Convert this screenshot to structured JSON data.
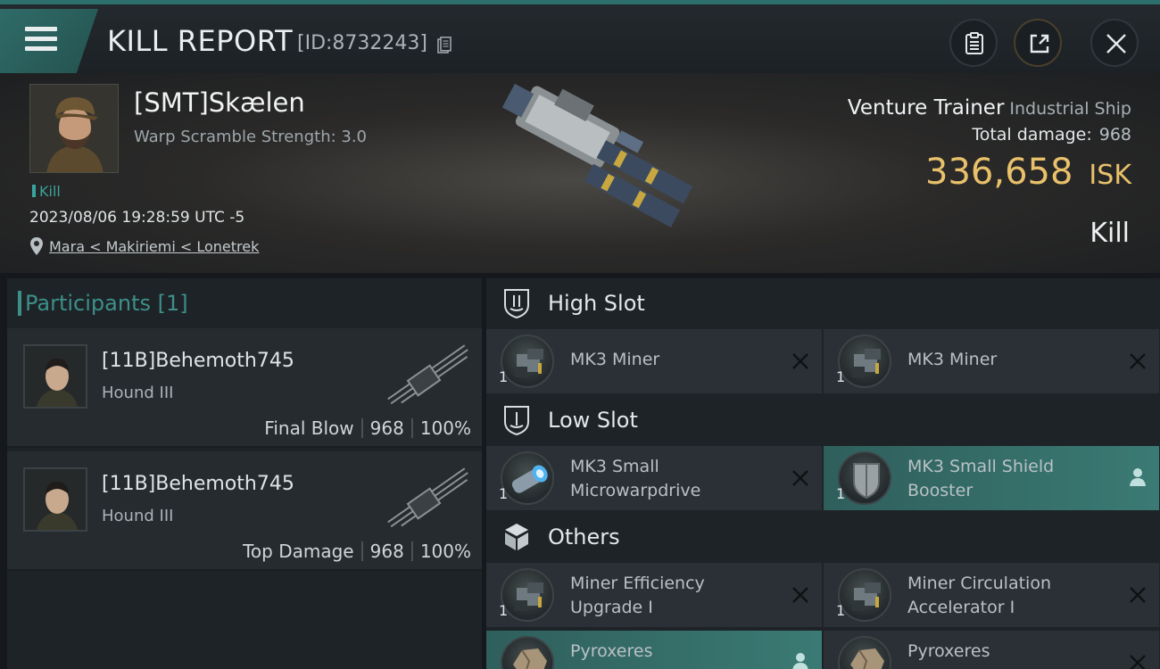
{
  "header": {
    "title": "KILL REPORT",
    "report_id": "[ID:8732243]"
  },
  "victim": {
    "name": "[SMT]Skælen",
    "warp_scramble": "Warp Scramble Strength: 3.0",
    "kill_tag": "Kill",
    "datetime": "2023/08/06 19:28:59 UTC -5",
    "location": "Mara < Makiriemi < Lonetrek"
  },
  "ship": {
    "name": "Venture Trainer",
    "class": "Industrial Ship",
    "total_damage_label": "Total damage:",
    "total_damage": "968",
    "isk_value": "336,658",
    "isk_unit": "ISK",
    "result": "Kill"
  },
  "participants": {
    "header": "Participants [1]",
    "items": [
      {
        "name": "[11B]Behemoth745",
        "ship": "Hound III",
        "role": "Final Blow",
        "damage": "968",
        "percent": "100%"
      },
      {
        "name": "[11B]Behemoth745",
        "ship": "Hound III",
        "role": "Top Damage",
        "damage": "968",
        "percent": "100%"
      }
    ]
  },
  "slots": {
    "high": {
      "label": "High Slot",
      "items": [
        {
          "name": "MK3 Miner",
          "qty": "1"
        },
        {
          "name": "MK3 Miner",
          "qty": "1"
        }
      ]
    },
    "low": {
      "label": "Low Slot",
      "items": [
        {
          "name": "MK3 Small Microwarpdrive",
          "qty": "1"
        },
        {
          "name": "MK3 Small Shield Booster",
          "qty": "1"
        }
      ]
    },
    "others": {
      "label": "Others",
      "items": [
        {
          "name": "Miner Efficiency Upgrade I",
          "qty": "1"
        },
        {
          "name": "Miner Circulation Accelerator I",
          "qty": "1"
        },
        {
          "name": "Pyroxeres",
          "qty": ""
        },
        {
          "name": "Pyroxeres",
          "qty": ""
        }
      ]
    }
  },
  "colors": {
    "accent": "#3d8f8a",
    "isk": "#e9c16b",
    "highlight": "#3b7a74"
  }
}
